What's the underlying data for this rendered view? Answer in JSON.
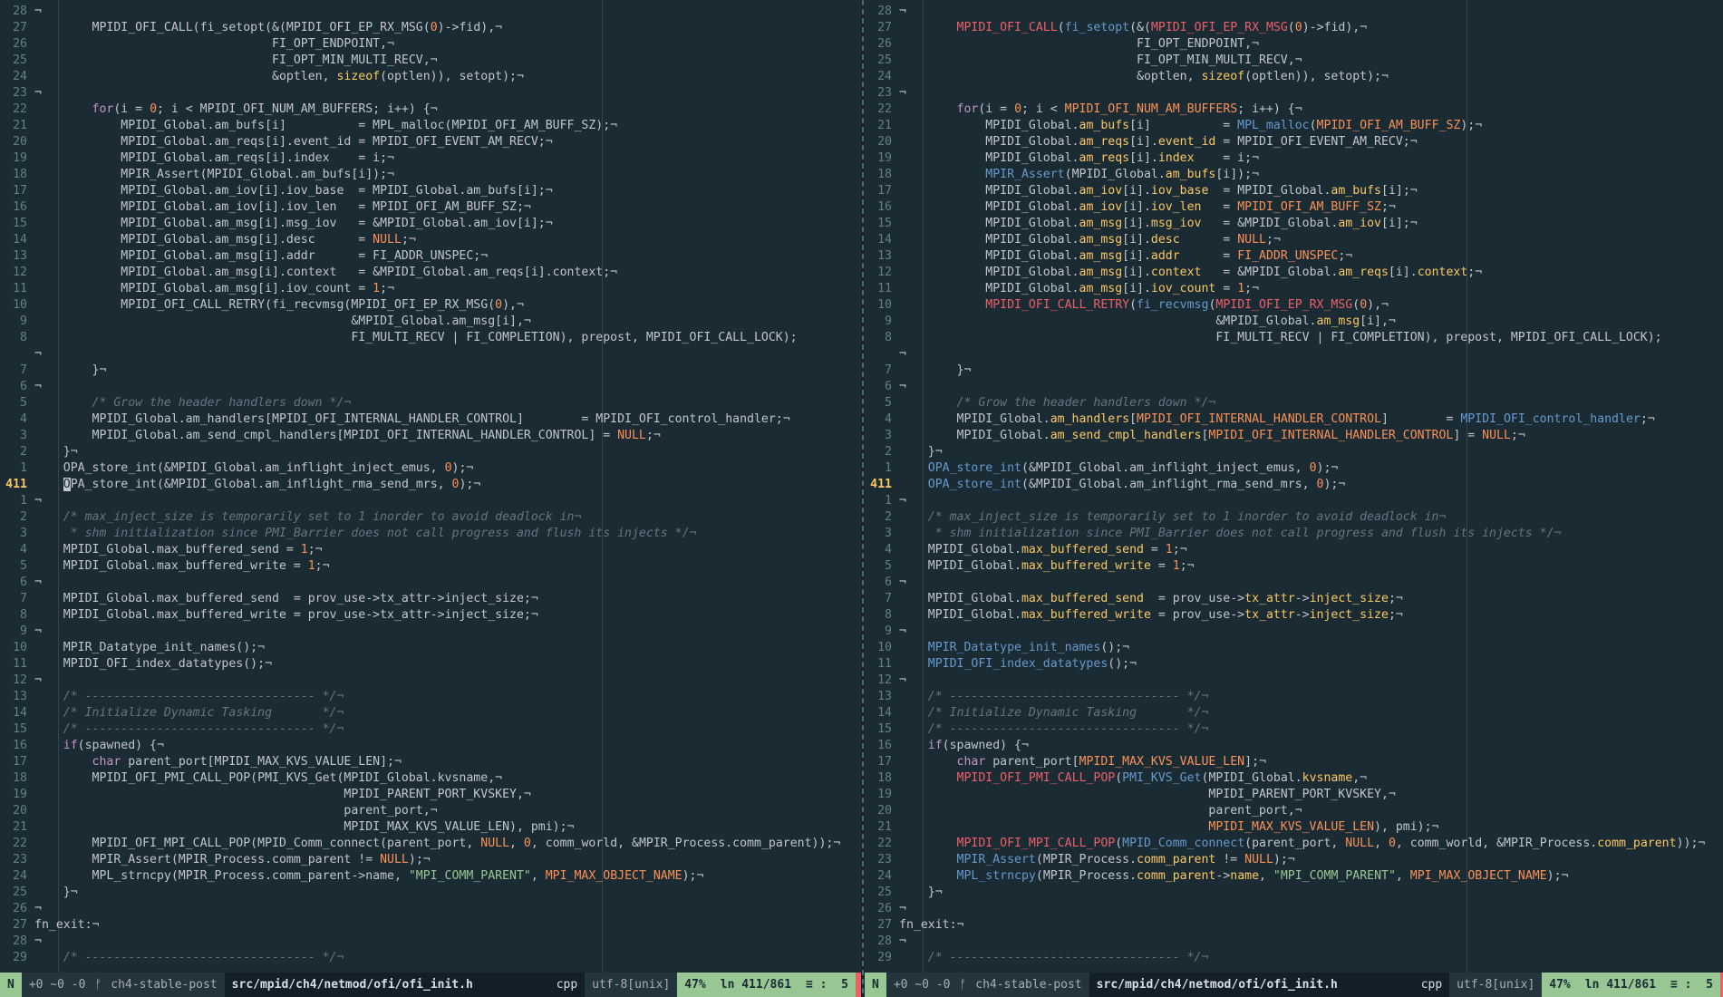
{
  "colors": {
    "background": "#1b2b34",
    "keyword": "#c594c5",
    "number": "#f99157",
    "string": "#99c794",
    "comment": "#65737e",
    "macro": "#ec5f67",
    "function": "#6699cc",
    "field": "#fac863",
    "current_line_number": "#fac863"
  },
  "panes": [
    {
      "id": "left",
      "current_line": "411",
      "lines": [
        {
          "n": "28",
          "t": "¬"
        },
        {
          "n": "27",
          "t": "        MPIDI_OFI_CALL(fi_setopt(&(MPIDI_OFI_EP_RX_MSG(0)->fid),¬"
        },
        {
          "n": "26",
          "t": "                                 FI_OPT_ENDPOINT,¬"
        },
        {
          "n": "25",
          "t": "                                 FI_OPT_MIN_MULTI_RECV,¬"
        },
        {
          "n": "24",
          "t": "                                 &optlen, sizeof(optlen)), setopt);¬"
        },
        {
          "n": "23",
          "t": "¬"
        },
        {
          "n": "22",
          "t": "        for(i = 0; i < MPIDI_OFI_NUM_AM_BUFFERS; i++) {¬"
        },
        {
          "n": "21",
          "t": "            MPIDI_Global.am_bufs[i]          = MPL_malloc(MPIDI_OFI_AM_BUFF_SZ);¬"
        },
        {
          "n": "20",
          "t": "            MPIDI_Global.am_reqs[i].event_id = MPIDI_OFI_EVENT_AM_RECV;¬"
        },
        {
          "n": "19",
          "t": "            MPIDI_Global.am_reqs[i].index    = i;¬"
        },
        {
          "n": "18",
          "t": "            MPIR_Assert(MPIDI_Global.am_bufs[i]);¬"
        },
        {
          "n": "17",
          "t": "            MPIDI_Global.am_iov[i].iov_base  = MPIDI_Global.am_bufs[i];¬"
        },
        {
          "n": "16",
          "t": "            MPIDI_Global.am_iov[i].iov_len   = MPIDI_OFI_AM_BUFF_SZ;¬"
        },
        {
          "n": "15",
          "t": "            MPIDI_Global.am_msg[i].msg_iov   = &MPIDI_Global.am_iov[i];¬"
        },
        {
          "n": "14",
          "t": "            MPIDI_Global.am_msg[i].desc      = NULL;¬"
        },
        {
          "n": "13",
          "t": "            MPIDI_Global.am_msg[i].addr      = FI_ADDR_UNSPEC;¬"
        },
        {
          "n": "12",
          "t": "            MPIDI_Global.am_msg[i].context   = &MPIDI_Global.am_reqs[i].context;¬"
        },
        {
          "n": "11",
          "t": "            MPIDI_Global.am_msg[i].iov_count = 1;¬"
        },
        {
          "n": "10",
          "t": "            MPIDI_OFI_CALL_RETRY(fi_recvmsg(MPIDI_OFI_EP_RX_MSG(0),¬"
        },
        {
          "n": "9",
          "t": "                                            &MPIDI_Global.am_msg[i],¬"
        },
        {
          "n": "8",
          "t": "                                            FI_MULTI_RECV | FI_COMPLETION), prepost, MPIDI_OFI_CALL_LOCK);"
        },
        {
          "n": "",
          "t": "¬"
        },
        {
          "n": "7",
          "t": "        }¬"
        },
        {
          "n": "6",
          "t": "¬"
        },
        {
          "n": "5",
          "t": "        /* Grow the header handlers down */¬"
        },
        {
          "n": "4",
          "t": "        MPIDI_Global.am_handlers[MPIDI_OFI_INTERNAL_HANDLER_CONTROL]        = MPIDI_OFI_control_handler;¬"
        },
        {
          "n": "3",
          "t": "        MPIDI_Global.am_send_cmpl_handlers[MPIDI_OFI_INTERNAL_HANDLER_CONTROL] = NULL;¬"
        },
        {
          "n": "2",
          "t": "    }¬"
        },
        {
          "n": "1",
          "t": "    OPA_store_int(&MPIDI_Global.am_inflight_inject_emus, 0);¬"
        },
        {
          "n": "411",
          "t": "    OPA_store_int(&MPIDI_Global.am_inflight_rma_send_mrs, 0);¬"
        },
        {
          "n": "1",
          "t": "¬"
        },
        {
          "n": "2",
          "t": "    /* max_inject_size is temporarily set to 1 inorder to avoid deadlock in¬"
        },
        {
          "n": "3",
          "t": "     * shm initialization since PMI_Barrier does not call progress and flush its injects */¬"
        },
        {
          "n": "4",
          "t": "    MPIDI_Global.max_buffered_send = 1;¬"
        },
        {
          "n": "5",
          "t": "    MPIDI_Global.max_buffered_write = 1;¬"
        },
        {
          "n": "6",
          "t": "¬"
        },
        {
          "n": "7",
          "t": "    MPIDI_Global.max_buffered_send  = prov_use->tx_attr->inject_size;¬"
        },
        {
          "n": "8",
          "t": "    MPIDI_Global.max_buffered_write = prov_use->tx_attr->inject_size;¬"
        },
        {
          "n": "9",
          "t": "¬"
        },
        {
          "n": "10",
          "t": "    MPIR_Datatype_init_names();¬"
        },
        {
          "n": "11",
          "t": "    MPIDI_OFI_index_datatypes();¬"
        },
        {
          "n": "12",
          "t": "¬"
        },
        {
          "n": "13",
          "t": "    /* -------------------------------- */¬"
        },
        {
          "n": "14",
          "t": "    /* Initialize Dynamic Tasking       */¬"
        },
        {
          "n": "15",
          "t": "    /* -------------------------------- */¬"
        },
        {
          "n": "16",
          "t": "    if(spawned) {¬"
        },
        {
          "n": "17",
          "t": "        char parent_port[MPIDI_MAX_KVS_VALUE_LEN];¬"
        },
        {
          "n": "18",
          "t": "        MPIDI_OFI_PMI_CALL_POP(PMI_KVS_Get(MPIDI_Global.kvsname,¬"
        },
        {
          "n": "19",
          "t": "                                           MPIDI_PARENT_PORT_KVSKEY,¬"
        },
        {
          "n": "20",
          "t": "                                           parent_port,¬"
        },
        {
          "n": "21",
          "t": "                                           MPIDI_MAX_KVS_VALUE_LEN), pmi);¬"
        },
        {
          "n": "22",
          "t": "        MPIDI_OFI_MPI_CALL_POP(MPID_Comm_connect(parent_port, NULL, 0, comm_world, &MPIR_Process.comm_parent));¬"
        },
        {
          "n": "23",
          "t": "        MPIR_Assert(MPIR_Process.comm_parent != NULL);¬"
        },
        {
          "n": "24",
          "t": "        MPL_strncpy(MPIR_Process.comm_parent->name, \"MPI_COMM_PARENT\", MPI_MAX_OBJECT_NAME);¬"
        },
        {
          "n": "25",
          "t": "    }¬"
        },
        {
          "n": "26",
          "t": "¬"
        },
        {
          "n": "27",
          "t": "fn_exit:¬"
        },
        {
          "n": "28",
          "t": "¬"
        },
        {
          "n": "29",
          "t": "    /* -------------------------------- */¬"
        }
      ],
      "status": {
        "mode": "N",
        "git_diff": "+0 ~0 -0",
        "branch_icon": "ᚠ",
        "branch": "ch4-stable-post",
        "path": "src/mpid/ch4/netmod/ofi/ofi_init.h",
        "filetype": "cpp",
        "encoding": "utf-8[unix]",
        "percent": "47%",
        "position": "ln 411/861",
        "column": "≡ :  5"
      }
    },
    {
      "id": "right",
      "current_line": "411",
      "lines": "same-as-left",
      "status": {
        "mode": "N",
        "git_diff": "+0 ~0 -0",
        "branch_icon": "ᚠ",
        "branch": "ch4-stable-post",
        "path": "src/mpid/ch4/netmod/ofi/ofi_init.h",
        "filetype": "cpp",
        "encoding": "utf-8[unix]",
        "percent": "47%",
        "position": "ln 411/861",
        "column": "≡ :  5"
      }
    }
  ]
}
